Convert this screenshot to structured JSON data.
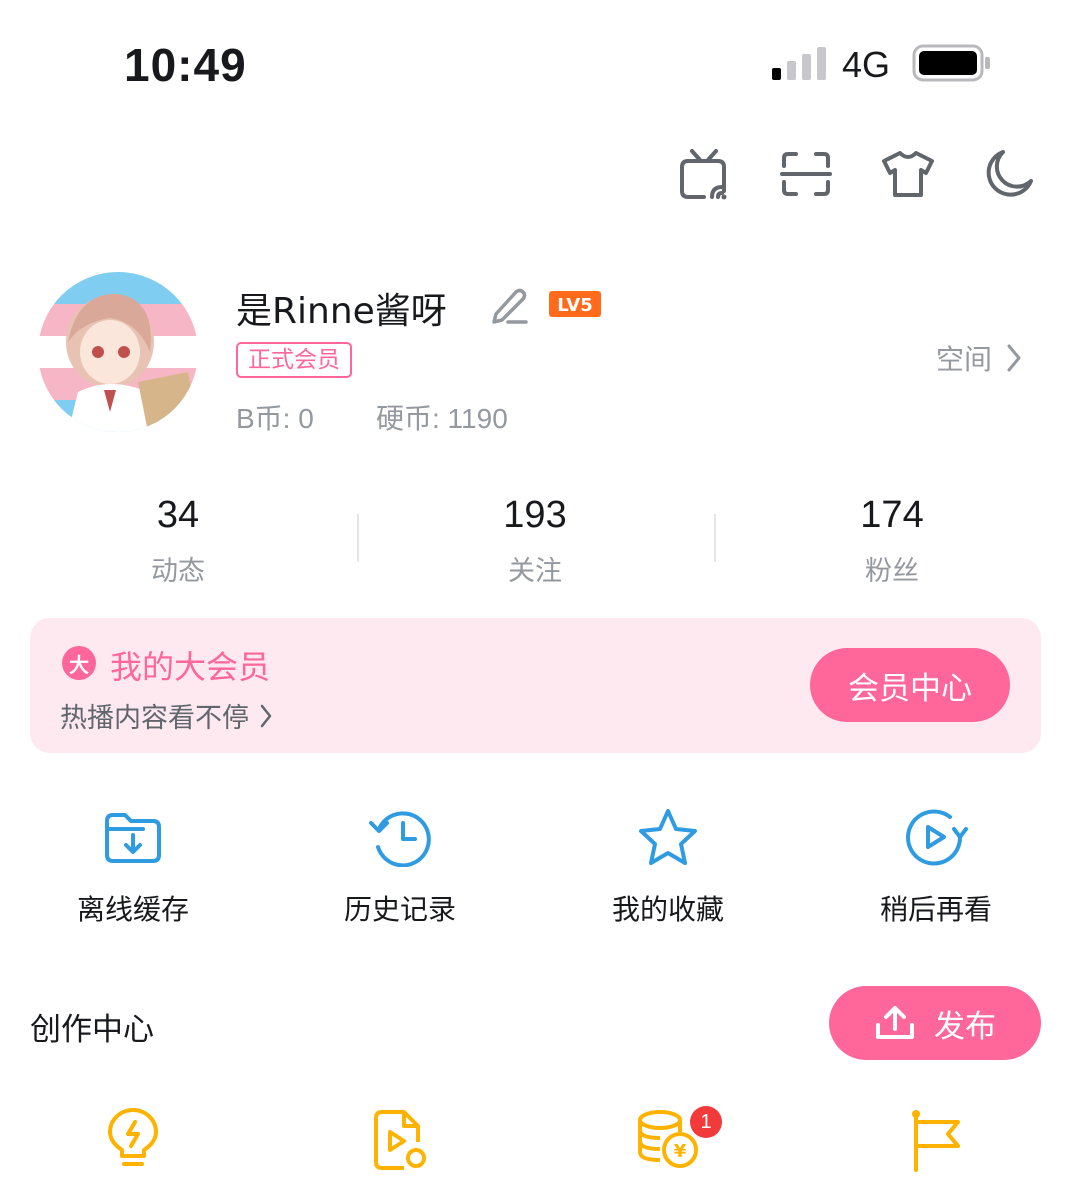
{
  "status_bar": {
    "time": "10:49",
    "network": "4G"
  },
  "toolbar": {
    "icons": [
      "cast-icon",
      "scan-icon",
      "tshirt-icon",
      "moon-icon"
    ]
  },
  "profile": {
    "username": "是Rinne酱呀",
    "level": "LV5",
    "member_badge": "正式会员",
    "b_coin": "B币: 0",
    "coins": "硬币: 1190",
    "space_link": "空间"
  },
  "stats": [
    {
      "num": "34",
      "label": "动态"
    },
    {
      "num": "193",
      "label": "关注"
    },
    {
      "num": "174",
      "label": "粉丝"
    }
  ],
  "vip": {
    "icon_text": "大",
    "title": "我的大会员",
    "subtitle": "热播内容看不停",
    "button": "会员中心"
  },
  "quick_actions": [
    {
      "label": "离线缓存",
      "icon": "download-folder-icon"
    },
    {
      "label": "历史记录",
      "icon": "history-icon"
    },
    {
      "label": "我的收藏",
      "icon": "star-icon"
    },
    {
      "label": "稍后再看",
      "icon": "watch-later-icon"
    }
  ],
  "creation": {
    "title": "创作中心",
    "publish": "发布",
    "badge_count": "1",
    "icons": [
      "lightbulb-icon",
      "video-file-icon",
      "coins-icon",
      "flag-icon"
    ]
  },
  "colors": {
    "pink": "#ff6699",
    "blue": "#2f9be0",
    "yellow": "#ffb300",
    "gray": "#9499a0"
  }
}
